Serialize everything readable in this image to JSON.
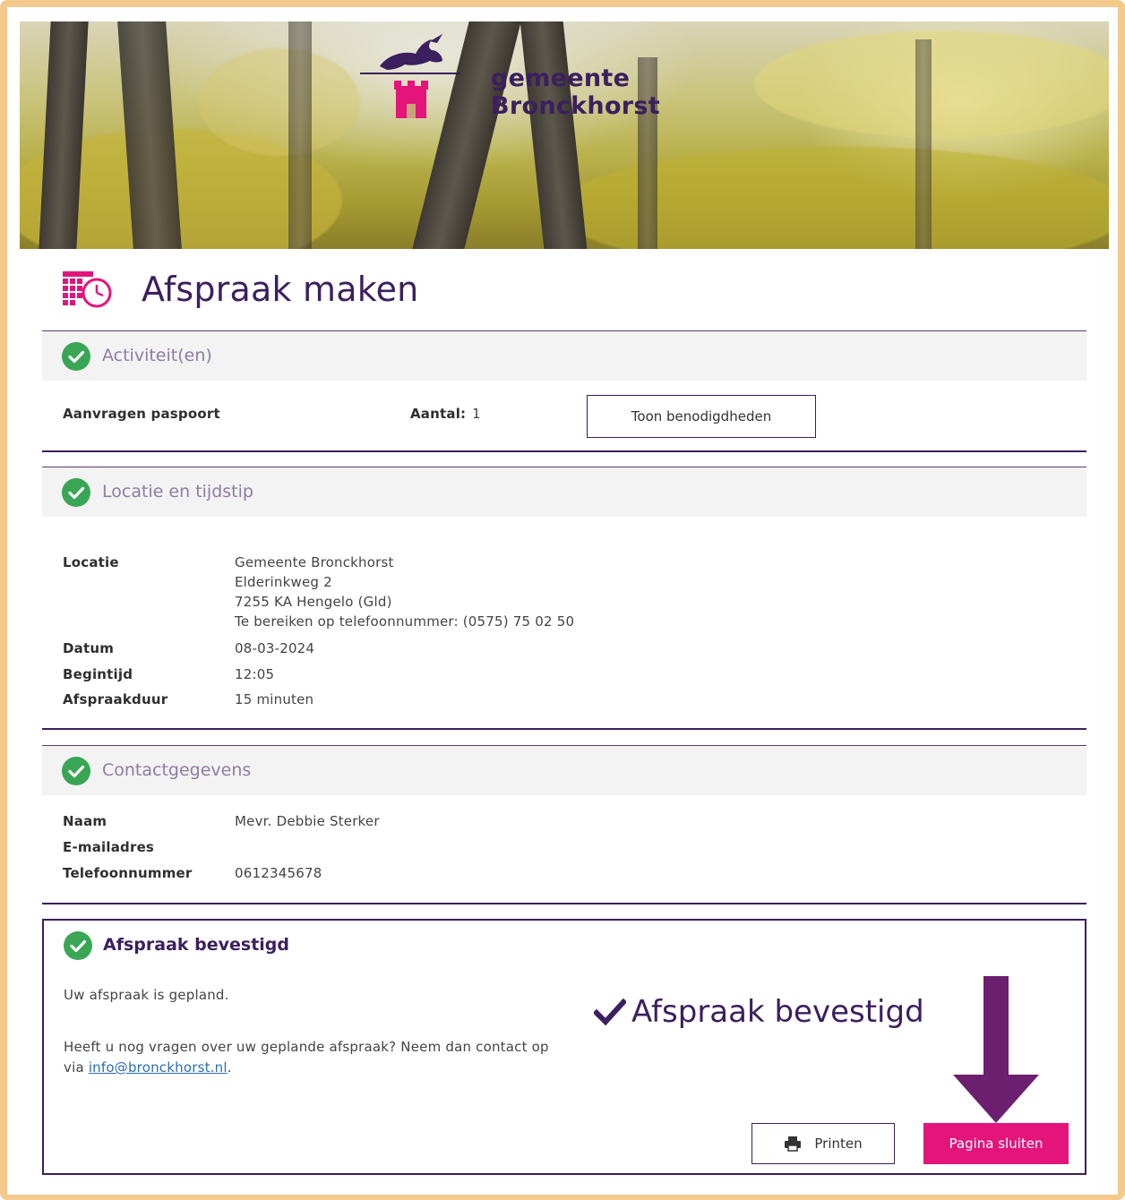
{
  "header": {
    "municipality_name": "gemeente Bronckhorst",
    "logo_icon": "hare-and-tower-crest-icon"
  },
  "page": {
    "title": "Afspraak maken",
    "title_icon": "calendar-clock-icon"
  },
  "activities": {
    "section_title": "Activiteit(en)",
    "item_name": "Aanvragen paspoort",
    "quantity_label": "Aantal:",
    "quantity_value": "1",
    "show_requirements_button": "Toon benodigdheden"
  },
  "location_time": {
    "section_title": "Locatie en tijdstip",
    "location_label": "Locatie",
    "location_lines": [
      "Gemeente Bronckhorst",
      "Elderinkweg 2",
      "7255 KA Hengelo (Gld)",
      "Te bereiken op telefoonnummer: (0575) 75 02 50"
    ],
    "date_label": "Datum",
    "date_value": "08-03-2024",
    "start_label": "Begintijd",
    "start_value": "12:05",
    "duration_label": "Afspraakduur",
    "duration_value": "15 minuten"
  },
  "contact": {
    "section_title": "Contactgegevens",
    "name_label": "Naam",
    "name_value": "Mevr. Debbie Sterker",
    "email_label": "E-mailadres",
    "email_value": "",
    "phone_label": "Telefoonnummer",
    "phone_value": "0612345678"
  },
  "confirmation": {
    "title": "Afspraak bevestigd",
    "planned_text": "Uw afspraak is gepland.",
    "questions_text_1": "Heeft u nog vragen over uw geplande afspraak? Neem dan contact op",
    "questions_text_2_prefix": "via ",
    "email_link": "info@bronckhorst.nl",
    "questions_text_2_suffix": ".",
    "big_label": "Afspraak bevestigd",
    "print_button": "Printen",
    "close_button": "Pagina sluiten"
  },
  "colors": {
    "brand_purple": "#3b1f5e",
    "accent_pink": "#e3147a",
    "success_green": "#3aa655",
    "frame_orange": "#f4c98e",
    "arrow_purple": "#6b1f6e"
  }
}
